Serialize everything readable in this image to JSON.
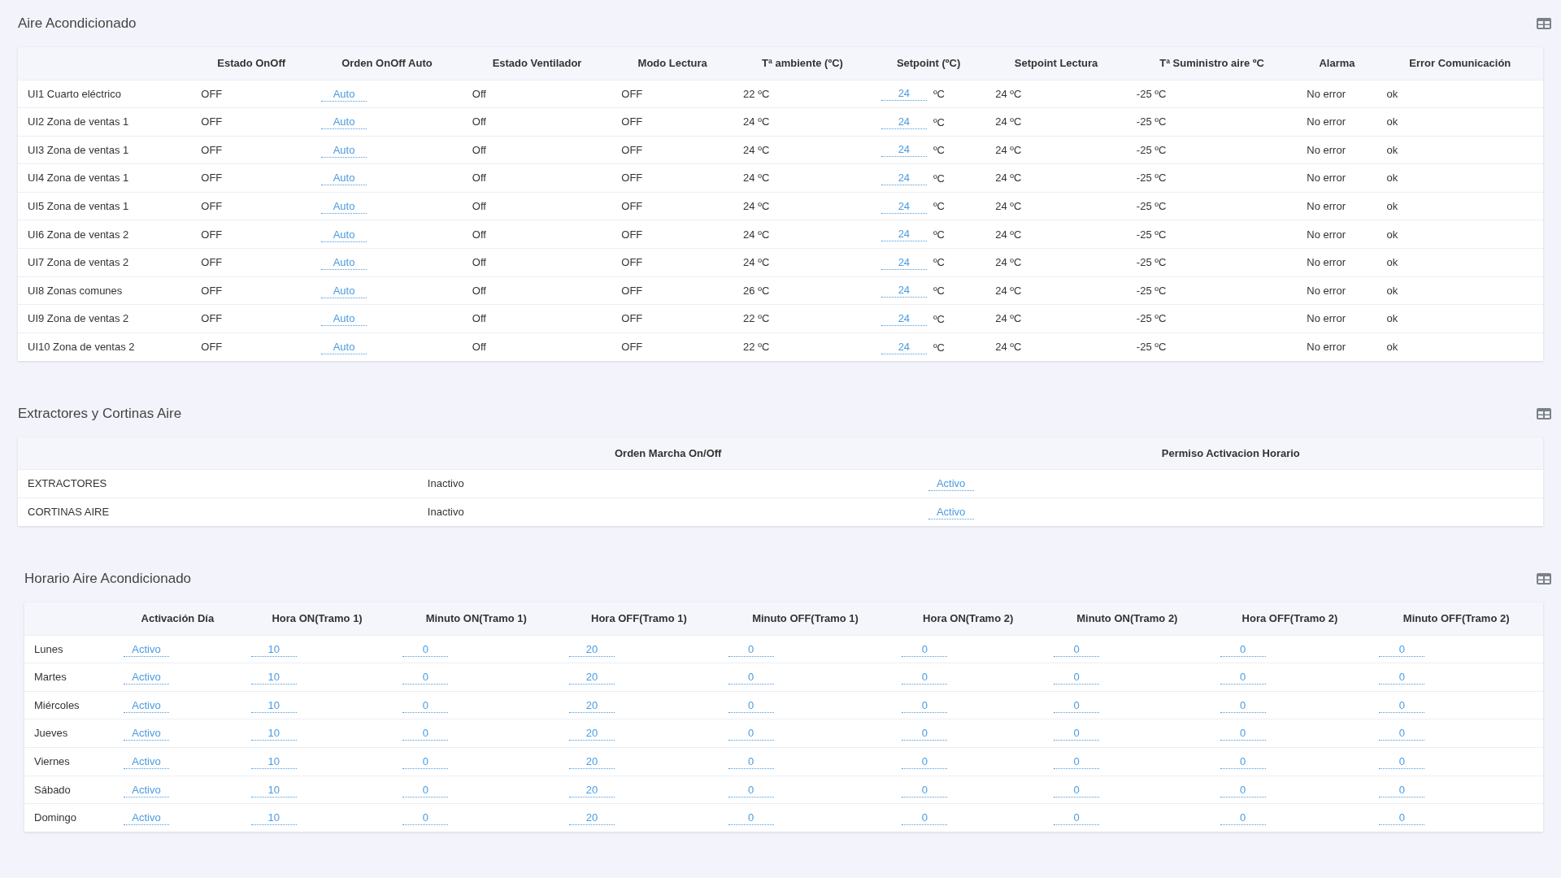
{
  "sections": [
    {
      "title": "Aire Acondicionado",
      "columns": [
        "",
        "Estado OnOff",
        "Orden OnOff Auto",
        "Estado Ventilador",
        "Modo Lectura",
        "Tª ambiente (ºC)",
        "Setpoint (ºC)",
        "Setpoint Lectura",
        "Tª Suministro aire ºC",
        "Alarma",
        "Error Comunicación"
      ],
      "rows": [
        [
          {
            "kind": "text",
            "text": "UI1 Cuarto eléctrico"
          },
          {
            "kind": "text",
            "text": "OFF"
          },
          {
            "kind": "link",
            "text": "Auto"
          },
          {
            "kind": "text",
            "text": "Off"
          },
          {
            "kind": "text",
            "text": "OFF"
          },
          {
            "kind": "text",
            "text": "22 ºC"
          },
          {
            "kind": "link",
            "text": "24",
            "unit": "ºC"
          },
          {
            "kind": "text",
            "text": "24 ºC"
          },
          {
            "kind": "text",
            "text": "-25 ºC"
          },
          {
            "kind": "text",
            "text": "No error"
          },
          {
            "kind": "text",
            "text": "ok"
          }
        ],
        [
          {
            "kind": "text",
            "text": "UI2 Zona de ventas 1"
          },
          {
            "kind": "text",
            "text": "OFF"
          },
          {
            "kind": "link",
            "text": "Auto"
          },
          {
            "kind": "text",
            "text": "Off"
          },
          {
            "kind": "text",
            "text": "OFF"
          },
          {
            "kind": "text",
            "text": "24 ºC"
          },
          {
            "kind": "link",
            "text": "24",
            "unit": "ºC"
          },
          {
            "kind": "text",
            "text": "24 ºC"
          },
          {
            "kind": "text",
            "text": "-25 ºC"
          },
          {
            "kind": "text",
            "text": "No error"
          },
          {
            "kind": "text",
            "text": "ok"
          }
        ],
        [
          {
            "kind": "text",
            "text": "UI3 Zona de ventas 1"
          },
          {
            "kind": "text",
            "text": "OFF"
          },
          {
            "kind": "link",
            "text": "Auto"
          },
          {
            "kind": "text",
            "text": "Off"
          },
          {
            "kind": "text",
            "text": "OFF"
          },
          {
            "kind": "text",
            "text": "24 ºC"
          },
          {
            "kind": "link",
            "text": "24",
            "unit": "ºC"
          },
          {
            "kind": "text",
            "text": "24 ºC"
          },
          {
            "kind": "text",
            "text": "-25 ºC"
          },
          {
            "kind": "text",
            "text": "No error"
          },
          {
            "kind": "text",
            "text": "ok"
          }
        ],
        [
          {
            "kind": "text",
            "text": "UI4 Zona de ventas 1"
          },
          {
            "kind": "text",
            "text": "OFF"
          },
          {
            "kind": "link",
            "text": "Auto"
          },
          {
            "kind": "text",
            "text": "Off"
          },
          {
            "kind": "text",
            "text": "OFF"
          },
          {
            "kind": "text",
            "text": "24 ºC"
          },
          {
            "kind": "link",
            "text": "24",
            "unit": "ºC"
          },
          {
            "kind": "text",
            "text": "24 ºC"
          },
          {
            "kind": "text",
            "text": "-25 ºC"
          },
          {
            "kind": "text",
            "text": "No error"
          },
          {
            "kind": "text",
            "text": "ok"
          }
        ],
        [
          {
            "kind": "text",
            "text": "UI5 Zona de ventas 1"
          },
          {
            "kind": "text",
            "text": "OFF"
          },
          {
            "kind": "link",
            "text": "Auto"
          },
          {
            "kind": "text",
            "text": "Off"
          },
          {
            "kind": "text",
            "text": "OFF"
          },
          {
            "kind": "text",
            "text": "24 ºC"
          },
          {
            "kind": "link",
            "text": "24",
            "unit": "ºC"
          },
          {
            "kind": "text",
            "text": "24 ºC"
          },
          {
            "kind": "text",
            "text": "-25 ºC"
          },
          {
            "kind": "text",
            "text": "No error"
          },
          {
            "kind": "text",
            "text": "ok"
          }
        ],
        [
          {
            "kind": "text",
            "text": "UI6 Zona de ventas 2"
          },
          {
            "kind": "text",
            "text": "OFF"
          },
          {
            "kind": "link",
            "text": "Auto"
          },
          {
            "kind": "text",
            "text": "Off"
          },
          {
            "kind": "text",
            "text": "OFF"
          },
          {
            "kind": "text",
            "text": "24 ºC"
          },
          {
            "kind": "link",
            "text": "24",
            "unit": "ºC"
          },
          {
            "kind": "text",
            "text": "24 ºC"
          },
          {
            "kind": "text",
            "text": "-25 ºC"
          },
          {
            "kind": "text",
            "text": "No error"
          },
          {
            "kind": "text",
            "text": "ok"
          }
        ],
        [
          {
            "kind": "text",
            "text": "UI7 Zona de ventas 2"
          },
          {
            "kind": "text",
            "text": "OFF"
          },
          {
            "kind": "link",
            "text": "Auto"
          },
          {
            "kind": "text",
            "text": "Off"
          },
          {
            "kind": "text",
            "text": "OFF"
          },
          {
            "kind": "text",
            "text": "24 ºC"
          },
          {
            "kind": "link",
            "text": "24",
            "unit": "ºC"
          },
          {
            "kind": "text",
            "text": "24 ºC"
          },
          {
            "kind": "text",
            "text": "-25 ºC"
          },
          {
            "kind": "text",
            "text": "No error"
          },
          {
            "kind": "text",
            "text": "ok"
          }
        ],
        [
          {
            "kind": "text",
            "text": "UI8 Zonas comunes"
          },
          {
            "kind": "text",
            "text": "OFF"
          },
          {
            "kind": "link",
            "text": "Auto"
          },
          {
            "kind": "text",
            "text": "Off"
          },
          {
            "kind": "text",
            "text": "OFF"
          },
          {
            "kind": "text",
            "text": "26 ºC"
          },
          {
            "kind": "link",
            "text": "24",
            "unit": "ºC"
          },
          {
            "kind": "text",
            "text": "24 ºC"
          },
          {
            "kind": "text",
            "text": "-25 ºC"
          },
          {
            "kind": "text",
            "text": "No error"
          },
          {
            "kind": "text",
            "text": "ok"
          }
        ],
        [
          {
            "kind": "text",
            "text": "UI9 Zona de ventas 2"
          },
          {
            "kind": "text",
            "text": "OFF"
          },
          {
            "kind": "link",
            "text": "Auto"
          },
          {
            "kind": "text",
            "text": "Off"
          },
          {
            "kind": "text",
            "text": "OFF"
          },
          {
            "kind": "text",
            "text": "22 ºC"
          },
          {
            "kind": "link",
            "text": "24",
            "unit": "ºC"
          },
          {
            "kind": "text",
            "text": "24 ºC"
          },
          {
            "kind": "text",
            "text": "-25 ºC"
          },
          {
            "kind": "text",
            "text": "No error"
          },
          {
            "kind": "text",
            "text": "ok"
          }
        ],
        [
          {
            "kind": "text",
            "text": "UI10 Zona de ventas 2"
          },
          {
            "kind": "text",
            "text": "OFF"
          },
          {
            "kind": "link",
            "text": "Auto"
          },
          {
            "kind": "text",
            "text": "Off"
          },
          {
            "kind": "text",
            "text": "OFF"
          },
          {
            "kind": "text",
            "text": "22 ºC"
          },
          {
            "kind": "link",
            "text": "24",
            "unit": "ºC"
          },
          {
            "kind": "text",
            "text": "24 ºC"
          },
          {
            "kind": "text",
            "text": "-25 ºC"
          },
          {
            "kind": "text",
            "text": "No error"
          },
          {
            "kind": "text",
            "text": "ok"
          }
        ]
      ]
    },
    {
      "title": "Extractores y Cortinas Aire",
      "columns": [
        "",
        "Orden Marcha On/Off",
        "Permiso Activacion Horario"
      ],
      "rows": [
        [
          {
            "kind": "text",
            "text": "EXTRACTORES"
          },
          {
            "kind": "text",
            "text": "Inactivo"
          },
          {
            "kind": "link",
            "text": "Activo"
          }
        ],
        [
          {
            "kind": "text",
            "text": "CORTINAS AIRE"
          },
          {
            "kind": "text",
            "text": "Inactivo"
          },
          {
            "kind": "link",
            "text": "Activo"
          }
        ]
      ]
    },
    {
      "title": "Horario Aire Acondicionado",
      "columns": [
        "",
        "Activación Día",
        "Hora ON(Tramo 1)",
        "Minuto ON(Tramo 1)",
        "Hora OFF(Tramo 1)",
        "Minuto OFF(Tramo 1)",
        "Hora ON(Tramo 2)",
        "Minuto ON(Tramo 2)",
        "Hora OFF(Tramo 2)",
        "Minuto OFF(Tramo 2)"
      ],
      "rows": [
        [
          {
            "kind": "text",
            "text": "Lunes"
          },
          {
            "kind": "link",
            "text": "Activo"
          },
          {
            "kind": "link",
            "text": "10"
          },
          {
            "kind": "link",
            "text": "0"
          },
          {
            "kind": "link",
            "text": "20"
          },
          {
            "kind": "link",
            "text": "0"
          },
          {
            "kind": "link",
            "text": "0"
          },
          {
            "kind": "link",
            "text": "0"
          },
          {
            "kind": "link",
            "text": "0"
          },
          {
            "kind": "link",
            "text": "0"
          }
        ],
        [
          {
            "kind": "text",
            "text": "Martes"
          },
          {
            "kind": "link",
            "text": "Activo"
          },
          {
            "kind": "link",
            "text": "10"
          },
          {
            "kind": "link",
            "text": "0"
          },
          {
            "kind": "link",
            "text": "20"
          },
          {
            "kind": "link",
            "text": "0"
          },
          {
            "kind": "link",
            "text": "0"
          },
          {
            "kind": "link",
            "text": "0"
          },
          {
            "kind": "link",
            "text": "0"
          },
          {
            "kind": "link",
            "text": "0"
          }
        ],
        [
          {
            "kind": "text",
            "text": "Miércoles"
          },
          {
            "kind": "link",
            "text": "Activo"
          },
          {
            "kind": "link",
            "text": "10"
          },
          {
            "kind": "link",
            "text": "0"
          },
          {
            "kind": "link",
            "text": "20"
          },
          {
            "kind": "link",
            "text": "0"
          },
          {
            "kind": "link",
            "text": "0"
          },
          {
            "kind": "link",
            "text": "0"
          },
          {
            "kind": "link",
            "text": "0"
          },
          {
            "kind": "link",
            "text": "0"
          }
        ],
        [
          {
            "kind": "text",
            "text": "Jueves"
          },
          {
            "kind": "link",
            "text": "Activo"
          },
          {
            "kind": "link",
            "text": "10"
          },
          {
            "kind": "link",
            "text": "0"
          },
          {
            "kind": "link",
            "text": "20"
          },
          {
            "kind": "link",
            "text": "0"
          },
          {
            "kind": "link",
            "text": "0"
          },
          {
            "kind": "link",
            "text": "0"
          },
          {
            "kind": "link",
            "text": "0"
          },
          {
            "kind": "link",
            "text": "0"
          }
        ],
        [
          {
            "kind": "text",
            "text": "Viernes"
          },
          {
            "kind": "link",
            "text": "Activo"
          },
          {
            "kind": "link",
            "text": "10"
          },
          {
            "kind": "link",
            "text": "0"
          },
          {
            "kind": "link",
            "text": "20"
          },
          {
            "kind": "link",
            "text": "0"
          },
          {
            "kind": "link",
            "text": "0"
          },
          {
            "kind": "link",
            "text": "0"
          },
          {
            "kind": "link",
            "text": "0"
          },
          {
            "kind": "link",
            "text": "0"
          }
        ],
        [
          {
            "kind": "text",
            "text": "Sábado"
          },
          {
            "kind": "link",
            "text": "Activo"
          },
          {
            "kind": "link",
            "text": "10"
          },
          {
            "kind": "link",
            "text": "0"
          },
          {
            "kind": "link",
            "text": "20"
          },
          {
            "kind": "link",
            "text": "0"
          },
          {
            "kind": "link",
            "text": "0"
          },
          {
            "kind": "link",
            "text": "0"
          },
          {
            "kind": "link",
            "text": "0"
          },
          {
            "kind": "link",
            "text": "0"
          }
        ],
        [
          {
            "kind": "text",
            "text": "Domingo"
          },
          {
            "kind": "link",
            "text": "Activo"
          },
          {
            "kind": "link",
            "text": "10"
          },
          {
            "kind": "link",
            "text": "0"
          },
          {
            "kind": "link",
            "text": "20"
          },
          {
            "kind": "link",
            "text": "0"
          },
          {
            "kind": "link",
            "text": "0"
          },
          {
            "kind": "link",
            "text": "0"
          },
          {
            "kind": "link",
            "text": "0"
          },
          {
            "kind": "link",
            "text": "0"
          }
        ]
      ]
    }
  ]
}
